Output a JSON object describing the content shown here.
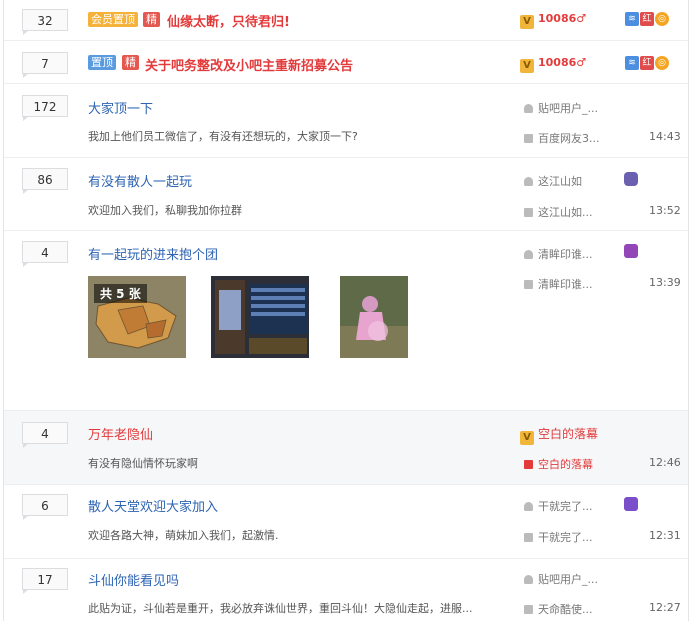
{
  "threads": [
    {
      "reply_count": "32",
      "badges": [
        "会员置顶",
        "精"
      ],
      "title": "仙缘太断，只待君归!",
      "author": "10086♂",
      "icons": [
        "≋",
        "红",
        "◎"
      ]
    },
    {
      "reply_count": "7",
      "badges": [
        "置顶",
        "精"
      ],
      "title": "关于吧务整改及小吧主重新招募公告",
      "author": "10086♂",
      "icons": [
        "≋",
        "红",
        "◎"
      ]
    },
    {
      "reply_count": "172",
      "title": "大家顶一下",
      "abstract": "我加上他们员工微信了，有没有还想玩的，大家顶一下?",
      "author": "贴吧用户_...",
      "last_reply": "百度网友3...",
      "time": "14:43"
    },
    {
      "reply_count": "86",
      "title": "有没有散人一起玩",
      "abstract": "欢迎加入我们，私聊我加你拉群",
      "author": "这江山如",
      "last_reply": "这江山如...",
      "time": "13:52"
    },
    {
      "reply_count": "4",
      "title": "有一起玩的进来抱个团",
      "image_count": "共 5 张",
      "author": "清眸印谁...",
      "last_reply": "清眸印谁...",
      "time": "13:39"
    },
    {
      "reply_count": "4",
      "title": "万年老隐仙",
      "abstract": "有没有隐仙情怀玩家啊",
      "author": "空白的落幕",
      "last_reply": "空白的落幕",
      "time": "12:46"
    },
    {
      "reply_count": "6",
      "title": "散人天堂欢迎大家加入",
      "abstract": "欢迎各路大神，萌妹加入我们，起激情.",
      "author": "干就完了...",
      "last_reply": "干就完了...",
      "time": "12:31"
    },
    {
      "reply_count": "17",
      "title": "斗仙你能看见吗",
      "abstract": "此贴为证，斗仙若是重开，我必放弃诛仙世界，重回斗仙！大隐仙走起，进服...",
      "author": "贴吧用户_...",
      "last_reply": "天命酷使...",
      "time": "12:27"
    }
  ],
  "colors": {
    "link": "#2d64b3",
    "red": "#e33b3b",
    "badge_orange": "#f4b23b",
    "badge_blue": "#5a9be0"
  }
}
